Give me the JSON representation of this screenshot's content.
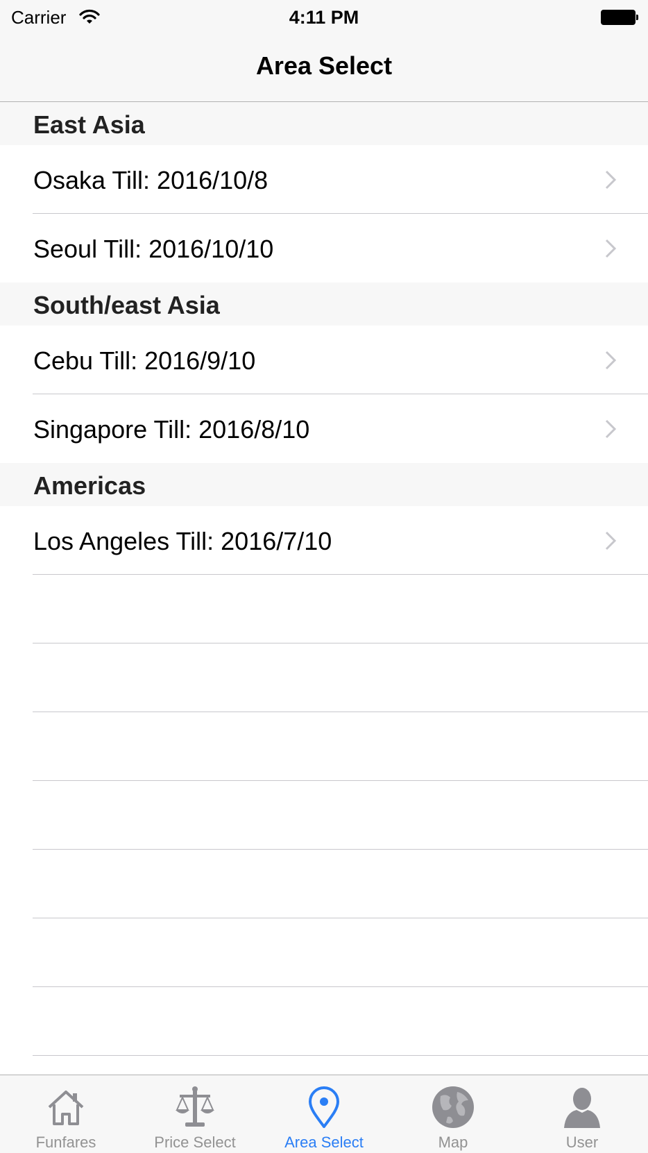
{
  "status_bar": {
    "carrier": "Carrier",
    "time": "4:11 PM"
  },
  "nav": {
    "title": "Area Select"
  },
  "sections": [
    {
      "header": "East Asia",
      "rows": [
        {
          "label": "Osaka Till: 2016/10/8"
        },
        {
          "label": "Seoul Till: 2016/10/10"
        }
      ]
    },
    {
      "header": "South/east Asia",
      "rows": [
        {
          "label": "Cebu Till: 2016/9/10"
        },
        {
          "label": "Singapore Till: 2016/8/10"
        }
      ]
    },
    {
      "header": "Americas",
      "rows": [
        {
          "label": "Los Angeles Till: 2016/7/10"
        }
      ]
    }
  ],
  "tabbar": {
    "active": "Area Select",
    "active_color": "#2a7ef5",
    "inactive_color": "#929292",
    "tabs": [
      {
        "label": "Funfares",
        "icon": "house-icon"
      },
      {
        "label": "Price Select",
        "icon": "scales-icon"
      },
      {
        "label": "Area Select",
        "icon": "location-pin-icon"
      },
      {
        "label": "Map",
        "icon": "globe-icon"
      },
      {
        "label": "User",
        "icon": "user-silhouette-icon"
      }
    ]
  }
}
